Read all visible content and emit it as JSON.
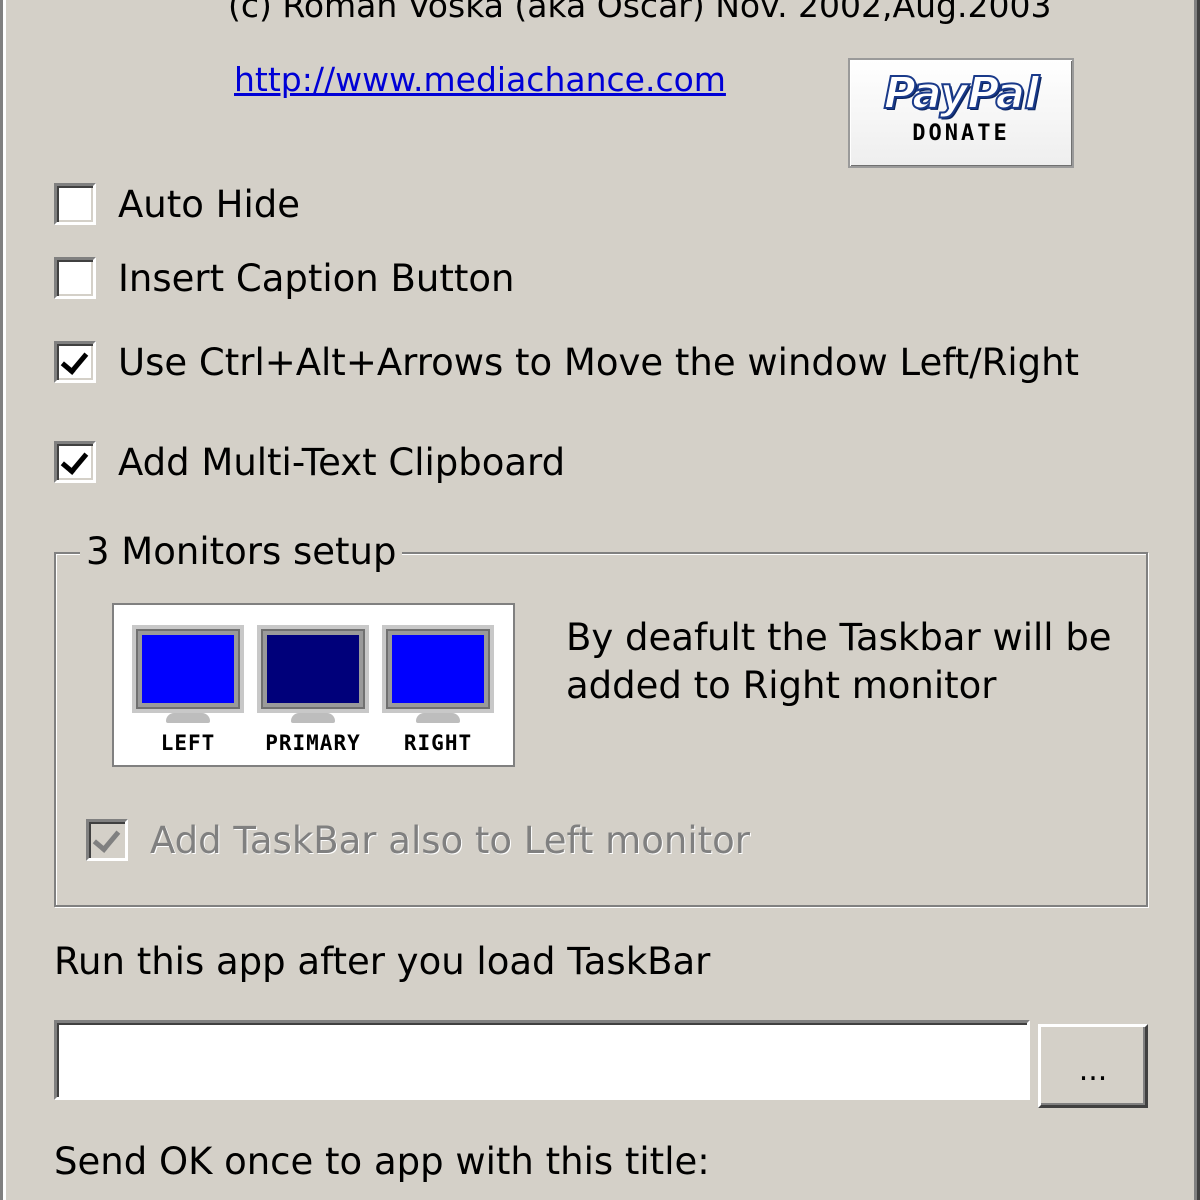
{
  "about": {
    "copyright": "(c) Roman Voska (aka Oscar) Nov. 2002,Aug.2003",
    "link": "http://www.mediachance.com"
  },
  "paypal": {
    "brand": "PayPal",
    "action": "DONATE"
  },
  "options": [
    {
      "label": "Auto Hide",
      "checked": false
    },
    {
      "label": "Insert Caption Button",
      "checked": false
    },
    {
      "label": "Use Ctrl+Alt+Arrows to Move the window Left/Right",
      "checked": true
    },
    {
      "label": "Add Multi-Text Clipboard",
      "checked": true
    }
  ],
  "monitors_group": {
    "title": "3 Monitors setup",
    "monitors": [
      {
        "label": "LEFT",
        "color": "#0000ff"
      },
      {
        "label": "PRIMARY",
        "color": "#00007a"
      },
      {
        "label": "RIGHT",
        "color": "#0000ff"
      }
    ],
    "info": "By deafult the Taskbar will be added to Right monitor",
    "left_option": {
      "label": "Add TaskBar also to Left monitor",
      "checked": true,
      "disabled": true
    }
  },
  "run_app": {
    "label": "Run this app after you load TaskBar",
    "value": "",
    "browse_label": "..."
  },
  "send_ok": {
    "label": "Send OK once to app with this title:"
  }
}
